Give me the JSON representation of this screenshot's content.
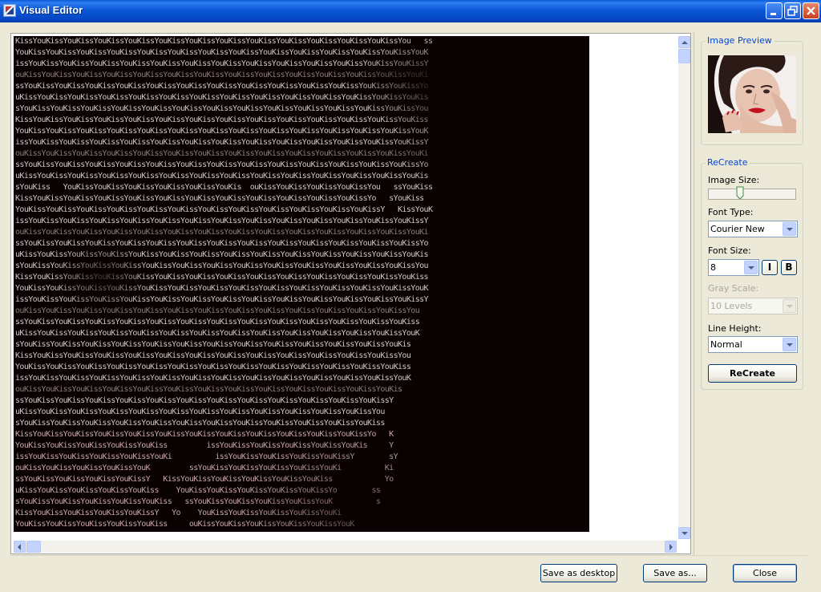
{
  "window": {
    "title": "Visual Editor"
  },
  "ascii_art": {
    "lines": [
      "KissYouKissYouKissYouKissYouKissYouKissYouKissYouKissYouKissYouKissYouKissYouKissYouKissYou   ss",
      "YouKissYouKissYouKissYouKissYouKissYouKissYouKissYouKissYouKissYouKissYouKissYouKissYouKissYouK",
      "issYouKissYouKissYouKissYouKissYouKissYouKissYouKissYouKissYouKissYouKissYouKissYouKissYouKissY",
      "ouKissYouKissYouKissYouKissYouKissYouKissYouKissYouKissYouKissYouKissYouKissYouKissYouKissYouKi",
      "ssYouKissYouKissYouKissYouKissYouKissYouKissYouKissYouKissYouKissYouKissYouKissYouKissYouKissYo",
      "uKissYouKissYouKissYouKissYouKissYouKissYouKissYouKissYouKissYouKissYouKissYouKissYouKissYouKis",
      "sYouKissYouKissYouKissYouKissYouKissYouKissYouKissYouKissYouKissYouKissYouKissYouKissYouKissYou",
      "KissYouKissYouKissYouKissYouKissYouKissYouKissYouKissYouKissYouKissYouKissYouKissYouKissYouKiss",
      "YouKissYouKissYouKissYouKissYouKissYouKissYouKissYouKissYouKissYouKissYouKissYouKissYouKissYouK",
      "issYouKissYouKissYouKissYouKissYouKissYouKissYouKissYouKissYouKissYouKissYouKissYouKissYouKissY",
      "ouKissYouKissYouKissYouKissYouKissYouKissYouKissYouKissYouKissYouKissYouKissYouKissYouKissYouKi",
      "ssYouKissYouKissYouKissYouKissYouKissYouKissYouKissYouKissYouKissYouKissYouKissYouKissYouKissYo",
      "uKissYouKissYouKissYouKissYouKissYouKissYouKissYouKissYouKissYouKissYouKissYouKissYouKissYouKis",
      "sYouKiss   YouKissYouKissYouKissYouKissYouKissYouKis  ouKissYouKissYouKissYouKissYou   ssYouKiss",
      "KissYouKissYouKissYouKissYouKissYouKissYouKissYouKissYouKissYouKissYouKissYouKissYo   sYouKiss",
      "YouKissYouKissYouKissYouKissYouKissYouKissYouKissYouKissYouKissYouKissYouKissYouKissY   KissYouK",
      "issYouKissYouKissYouKissYouKissYouKissYouKissYouKissYouKissYouKissYouKissYouKissYouKissYouKissY",
      "ouKissYouKissYouKissYouKissYouKissYouKissYouKissYouKissYouKissYouKissYouKissYouKissYouKissYouKi",
      "ssYouKissYouKissYouKissYouKissYouKissYouKissYouKissYouKissYouKissYouKissYouKissYouKissYouKissYo",
      "uKissYouKissYouKissYouKissYouKissYouKissYouKissYouKissYouKissYouKissYouKissYouKissYouKissYouKis",
      "sYouKissYouKissYouKissYouKissYouKissYouKissYouKissYouKissYouKissYouKissYouKissYouKissYouKissYou",
      "KissYouKissYouKissYouKissYouKissYouKissYouKissYouKissYouKissYouKissYouKissYouKissYouKissYouKiss",
      "YouKissYouKissYouKissYouKissYouKissYouKissYouKissYouKissYouKissYouKissYouKissYouKissYouKissYouK",
      "issYouKissYouKissYouKissYouKissYouKissYouKissYouKissYouKissYouKissYouKissYouKissYouKissYouKissY",
      "ouKissYouKissYouKissYouKissYouKissYouKissYouKissYouKissYouKissYouKissYouKissYouKissYouKissYou",
      "ssYouKissYouKissYouKissYouKissYouKissYouKissYouKissYouKissYouKissYouKissYouKissYouKissYouKiss",
      "uKissYouKissYouKissYouKissYouKissYouKissYouKissYouKissYouKissYouKissYouKissYouKissYouKissYouK",
      "sYouKissYouKissYouKissYouKissYouKissYouKissYouKissYouKissYouKissYouKissYouKissYouKissYouKis",
      "KissYouKissYouKissYouKissYouKissYouKissYouKissYouKissYouKissYouKissYouKissYouKissYouKissYou",
      "YouKissYouKissYouKissYouKissYouKissYouKissYouKissYouKissYouKissYouKissYouKissYouKissYouKiss",
      "issYouKissYouKissYouKissYouKissYouKissYouKissYouKissYouKissYouKissYouKissYouKissYouKissYouK",
      "ouKissYouKissYouKissYouKissYouKissYouKissYouKissYouKissYouKissYouKissYouKissYouKissYouKis",
      "ssYouKissYouKissYouKissYouKissYouKissYouKissYouKissYouKissYouKissYouKissYouKissYouKissY",
      "uKissYouKissYouKissYouKissYouKissYouKissYouKissYouKissYouKissYouKissYouKissYouKissYou",
      "sYouKissYouKissYouKissYouKissYouKissYouKissYouKissYouKissYouKissYouKissYouKissYouKiss",
      "KissYouKissYouKissYouKissYouKissYouKissYouKissYouKissYouKissYouKissYouKissYouKissYo   K",
      "YouKissYouKissYouKissYouKissYouKiss         issYouKissYouKissYouKissYouKissYouKis     Y",
      "issYouKissYouKissYouKissYouKissYouKi          issYouKissYouKissYouKissYouKissY        sY",
      "ouKissYouKissYouKissYouKissYouK         ssYouKissYouKissYouKissYouKissYouKi          Ki",
      "ssYouKissYouKissYouKissYouKissY   KissYouKissYouKissYouKissYouKissYouKiss            Yo",
      "uKissYouKissYouKissYouKissYouKiss    YouKissYouKissYouKissYouKissYouKissYo        ss",
      "sYouKissYouKissYouKissYouKissYouKiss   ssYouKissYouKissYouKissYouKissYouK          s",
      "KissYouKissYouKissYouKissYouKissY   Yo    YouKissYouKissYouKissYouKissYouKi",
      "YouKissYouKissYouKissYouKissYouKiss     ouKissYouKissYouKissYouKissYouKissYouK"
    ]
  },
  "image_preview": {
    "title": "Image Preview"
  },
  "recreate": {
    "title": "ReCreate",
    "image_size_label": "Image Size:",
    "image_size_value": 0.35,
    "font_type_label": "Font Type:",
    "font_type_value": "Courier New",
    "font_size_label": "Font Size:",
    "font_size_value": "8",
    "italic_label": "I",
    "bold_label": "B",
    "gray_scale_label": "Gray Scale:",
    "gray_scale_value": "10 Levels",
    "line_height_label": "Line Height:",
    "line_height_value": "Normal",
    "recreate_button": "ReCreate"
  },
  "footer": {
    "save_desktop": "Save as desktop",
    "save_as": "Save as...",
    "close": "Close"
  },
  "colors": {
    "titlebar": "#0a58d6",
    "group_title": "#0046d5",
    "ascii_bg": "#0a0202"
  }
}
